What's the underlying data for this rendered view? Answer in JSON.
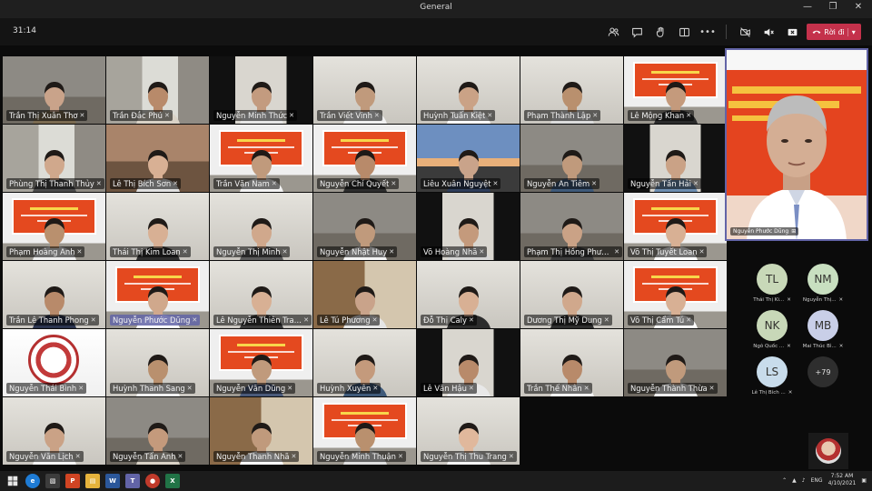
{
  "window": {
    "title": "General"
  },
  "meeting": {
    "timer": "31:14",
    "leave_label": "Rời đi"
  },
  "participants": [
    {
      "name": "Trần Thị Xuân Thơ",
      "scene": "room",
      "skin": "#c9a38a",
      "shirt": "#7a6a50"
    },
    {
      "name": "Trần Đắc Phú",
      "scene": "window",
      "skin": "#b88a6a",
      "shirt": "#d9d2c6"
    },
    {
      "name": "Nguyễn Minh Thức",
      "scene": "dark-wall",
      "skin": "#c39b7f",
      "shirt": "#e6e6e6"
    },
    {
      "name": "Trần Viết Vinh",
      "scene": "light",
      "skin": "#c09a7c",
      "shirt": "#f0f0f0"
    },
    {
      "name": "Huỳnh Tuấn Kiệt",
      "scene": "light",
      "skin": "#caa286",
      "shirt": "#ffffff"
    },
    {
      "name": "Phạm Thành Lập",
      "scene": "light",
      "skin": "#b9906e",
      "shirt": "#dcdcdc"
    },
    {
      "name": "Lê Mộng Khan",
      "scene": "banner",
      "skin": "#c49a7c",
      "shirt": "#2b2b2b"
    },
    {
      "name": "Phùng Thị Thanh Thủy",
      "scene": "window",
      "skin": "#d0a88c",
      "shirt": "#4a4a4a"
    },
    {
      "name": "Lê Thị Bích Sơn",
      "scene": "wood",
      "skin": "#d8b094",
      "shirt": "#e0e0e0"
    },
    {
      "name": "Trần Văn Nam",
      "scene": "banner",
      "skin": "#c09a7c",
      "shirt": "#f2f2f2"
    },
    {
      "name": "Nguyễn Chí Quyết",
      "scene": "banner",
      "skin": "#b88a6a",
      "shirt": "#2d2d2d"
    },
    {
      "name": "Liêu Xuân Nguyệt",
      "scene": "sky",
      "skin": "#c9a38a",
      "shirt": "#2e3d5a"
    },
    {
      "name": "Nguyễn An Tiêm",
      "scene": "room",
      "skin": "#c09a7c",
      "shirt": "#3f5a7a"
    },
    {
      "name": "Nguyễn Tấn Hải",
      "scene": "dark-wall",
      "skin": "#caa286",
      "shirt": "#6d8db0"
    },
    {
      "name": "Phạm Hoàng Anh",
      "scene": "banner",
      "skin": "#b9906e",
      "shirt": "#ededed"
    },
    {
      "name": "Thái Thị Kim Loan",
      "scene": "light",
      "skin": "#d8b094",
      "shirt": "#2f2f2f"
    },
    {
      "name": "Nguyễn Thị Minh",
      "scene": "light",
      "skin": "#d0a88c",
      "shirt": "#5a5a5a"
    },
    {
      "name": "Nguyễn Nhật Huy",
      "scene": "room",
      "skin": "#c09a7c",
      "shirt": "#f4f4f4"
    },
    {
      "name": "Võ Hoàng Nhã",
      "scene": "dark-wall",
      "skin": "#c49a7c",
      "shirt": "#d6d6d6"
    },
    {
      "name": "Phạm Thị Hồng Phượng",
      "scene": "room",
      "skin": "#caa286",
      "shirt": "#3d3d3d"
    },
    {
      "name": "Võ Thị Tuyết Loan",
      "scene": "banner",
      "skin": "#d8b094",
      "shirt": "#ffffff"
    },
    {
      "name": "Trần Lê Thanh Phong",
      "scene": "light",
      "skin": "#b88a6a",
      "shirt": "#2b3550"
    },
    {
      "name": "Nguyễn Phước Dũng",
      "scene": "banner",
      "skin": "#d0a88c",
      "shirt": "#ffffff",
      "active": true
    },
    {
      "name": "Lê Nguyễn Thiên Trang",
      "scene": "light",
      "skin": "#d8b094",
      "shirt": "#3a3a3a"
    },
    {
      "name": "Lê Tú Phương",
      "scene": "cabinet",
      "skin": "#c9a38a",
      "shirt": "#e5e5e5"
    },
    {
      "name": "Đỗ Thị Caly",
      "scene": "light",
      "skin": "#d8b094",
      "shirt": "#2c2c2c"
    },
    {
      "name": "Dương Thị Mỹ Dung",
      "scene": "light",
      "skin": "#d0a88c",
      "shirt": "#2f2f2f"
    },
    {
      "name": "Võ Thị Cẩm Tú",
      "scene": "banner",
      "skin": "#d8b094",
      "shirt": "#ffffff"
    },
    {
      "name": "Nguyễn Thái Bình",
      "scene": "logo",
      "skin": "#d8b094",
      "shirt": "#ffffff"
    },
    {
      "name": "Huỳnh Thanh Sang",
      "scene": "light",
      "skin": "#b9906e",
      "shirt": "#f0f0f0"
    },
    {
      "name": "Nguyễn Văn Dũng",
      "scene": "banner",
      "skin": "#c09a7c",
      "shirt": "#4a5a7a"
    },
    {
      "name": "Huỳnh Xuyên",
      "scene": "light",
      "skin": "#c49a7c",
      "shirt": "#3f5a7a"
    },
    {
      "name": "Lê Văn Hậu",
      "scene": "dark-wall",
      "skin": "#b88a6a",
      "shirt": "#e8e8e8"
    },
    {
      "name": "Trần Thế Nhân",
      "scene": "light",
      "skin": "#b88a6a",
      "shirt": "#f4f4f4"
    },
    {
      "name": "Nguyễn Thành Thừa",
      "scene": "room",
      "skin": "#c09a7c",
      "shirt": "#ededed"
    },
    {
      "name": "Nguyễn Văn Lịch",
      "scene": "light",
      "skin": "#caa286",
      "shirt": "#f6f6f6"
    },
    {
      "name": "Nguyễn Tấn Anh",
      "scene": "room",
      "skin": "#c49a7c",
      "shirt": "#d9d2c6"
    },
    {
      "name": "Nguyễn Thanh Nhã",
      "scene": "cabinet",
      "skin": "#c09a7c",
      "shirt": "#ffffff"
    },
    {
      "name": "Nguyễn Minh Thuận",
      "scene": "banner",
      "skin": "#b9906e",
      "shirt": "#e0e0e0"
    },
    {
      "name": "Nguyễn Thị Thu Trang",
      "scene": "light",
      "skin": "#e0b89c",
      "shirt": "#f5f5f5"
    }
  ],
  "spotlight": {
    "name": "Nguyễn Phước Dũng"
  },
  "avatars": [
    {
      "initials": "TL",
      "label": "Thái Thị Ki...",
      "color": "#c8d8b8"
    },
    {
      "initials": "NM",
      "label": "Nguyễn Thị...",
      "color": "#c8dfc0"
    },
    {
      "initials": "NK",
      "label": "Ngô Quốc ...",
      "color": "#c8d8b8"
    },
    {
      "initials": "MB",
      "label": "Mai Thúc Bì...",
      "color": "#c9cfe8"
    },
    {
      "initials": "LS",
      "label": "Lê Thị Bích ...",
      "color": "#c8dceb"
    },
    {
      "initials": "+79",
      "label": "",
      "color": "#2e2e2e"
    }
  ],
  "taskbar": {
    "lang": "ENG",
    "time": "7:52 AM",
    "date": "4/10/2021"
  }
}
